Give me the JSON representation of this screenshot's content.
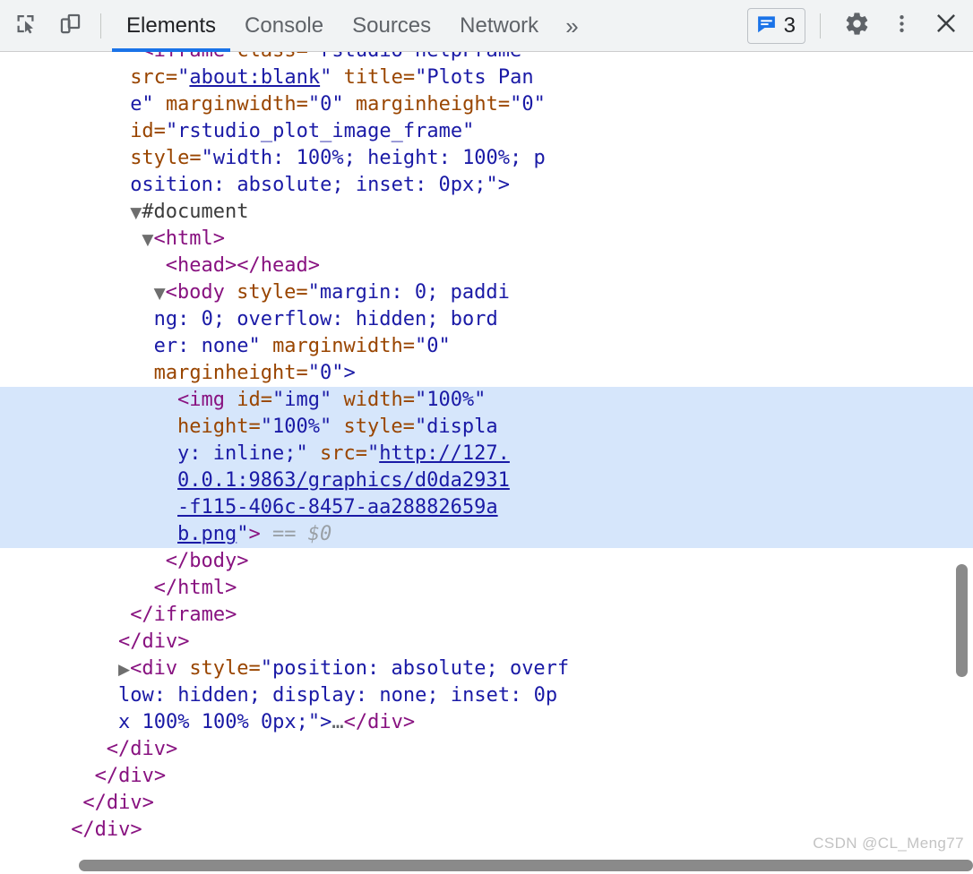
{
  "toolbar": {
    "inspect_icon": "inspect-element-icon",
    "device_icon": "device-toolbar-icon",
    "tabs": [
      {
        "label": "Elements",
        "active": true
      },
      {
        "label": "Console",
        "active": false
      },
      {
        "label": "Sources",
        "active": false
      },
      {
        "label": "Network",
        "active": false
      }
    ],
    "more_tabs_label": "»",
    "issues": {
      "icon": "issues-message-icon",
      "count": "3",
      "color": "#1a73e8"
    },
    "settings_icon": "gear-icon",
    "menu_icon": "kebab-menu-icon",
    "close_icon": "close-icon",
    "active_tab_underline_color": "#1a73e8",
    "background": "#f1f3f4"
  },
  "dom": {
    "selection_highlight_color": "#d6e6fb",
    "colors": {
      "tag": "#881280",
      "attribute": "#994500",
      "value": "#1a1aa6",
      "link": "#1a1aa6",
      "dollar_zero": "#9aa0a6"
    },
    "lines": [
      {
        "id": "l0",
        "clipped": true,
        "indent": 12,
        "parts": [
          {
            "t": "tag",
            "s": "<iframe"
          },
          {
            "t": "plain",
            "s": " "
          },
          {
            "t": "attr",
            "s": "class="
          },
          {
            "t": "val",
            "s": "\"rstudio helpFrame"
          }
        ]
      },
      {
        "id": "l1",
        "indent": 11,
        "parts": [
          {
            "t": "attr",
            "s": "src="
          },
          {
            "t": "val",
            "s": "\""
          },
          {
            "t": "link",
            "s": "about:blank"
          },
          {
            "t": "val",
            "s": "\""
          },
          {
            "t": "plain",
            "s": " "
          },
          {
            "t": "attr",
            "s": "title="
          },
          {
            "t": "val",
            "s": "\"Plots Pan"
          }
        ]
      },
      {
        "id": "l2",
        "indent": 11,
        "parts": [
          {
            "t": "val",
            "s": "e\""
          },
          {
            "t": "plain",
            "s": " "
          },
          {
            "t": "attr",
            "s": "marginwidth="
          },
          {
            "t": "val",
            "s": "\"0\""
          },
          {
            "t": "plain",
            "s": " "
          },
          {
            "t": "attr",
            "s": "marginheight="
          },
          {
            "t": "val",
            "s": "\"0\""
          }
        ]
      },
      {
        "id": "l3",
        "indent": 11,
        "parts": [
          {
            "t": "attr",
            "s": "id="
          },
          {
            "t": "val",
            "s": "\"rstudio_plot_image_frame\""
          }
        ]
      },
      {
        "id": "l4",
        "indent": 11,
        "parts": [
          {
            "t": "attr",
            "s": "style="
          },
          {
            "t": "val",
            "s": "\"width: 100%; height: 100%; p"
          }
        ]
      },
      {
        "id": "l5",
        "indent": 11,
        "parts": [
          {
            "t": "val",
            "s": "osition: absolute; inset: 0px;\">"
          }
        ]
      },
      {
        "id": "l6",
        "indent": 11,
        "twisty": "down",
        "parts": [
          {
            "t": "doc",
            "s": "#document"
          }
        ]
      },
      {
        "id": "l7",
        "indent": 12,
        "twisty": "down",
        "parts": [
          {
            "t": "tag",
            "s": "<html>"
          }
        ]
      },
      {
        "id": "l8",
        "indent": 14,
        "parts": [
          {
            "t": "tag",
            "s": "<head></head>"
          }
        ]
      },
      {
        "id": "l9",
        "indent": 13,
        "twisty": "down",
        "parts": [
          {
            "t": "tag",
            "s": "<body"
          },
          {
            "t": "plain",
            "s": " "
          },
          {
            "t": "attr",
            "s": "style="
          },
          {
            "t": "val",
            "s": "\"margin: 0; paddi"
          }
        ]
      },
      {
        "id": "l10",
        "indent": 13,
        "parts": [
          {
            "t": "val",
            "s": "ng: 0; overflow: hidden; bord"
          }
        ]
      },
      {
        "id": "l11",
        "indent": 13,
        "parts": [
          {
            "t": "val",
            "s": "er: none\""
          },
          {
            "t": "plain",
            "s": " "
          },
          {
            "t": "attr",
            "s": "marginwidth="
          },
          {
            "t": "val",
            "s": "\"0\""
          }
        ]
      },
      {
        "id": "l12",
        "indent": 13,
        "parts": [
          {
            "t": "attr",
            "s": "marginheight="
          },
          {
            "t": "val",
            "s": "\"0\">"
          }
        ]
      },
      {
        "id": "l13",
        "indent": 15,
        "selected": true,
        "parts": [
          {
            "t": "tag",
            "s": "<img"
          },
          {
            "t": "plain",
            "s": " "
          },
          {
            "t": "attr",
            "s": "id="
          },
          {
            "t": "val",
            "s": "\"img\""
          },
          {
            "t": "plain",
            "s": " "
          },
          {
            "t": "attr",
            "s": "width="
          },
          {
            "t": "val",
            "s": "\"100%\""
          }
        ]
      },
      {
        "id": "l14",
        "indent": 15,
        "selected": true,
        "parts": [
          {
            "t": "attr",
            "s": "height="
          },
          {
            "t": "val",
            "s": "\"100%\""
          },
          {
            "t": "plain",
            "s": " "
          },
          {
            "t": "attr",
            "s": "style="
          },
          {
            "t": "val",
            "s": "\"displa"
          }
        ]
      },
      {
        "id": "l15",
        "indent": 15,
        "selected": true,
        "parts": [
          {
            "t": "val",
            "s": "y: inline;\""
          },
          {
            "t": "plain",
            "s": " "
          },
          {
            "t": "attr",
            "s": "src="
          },
          {
            "t": "val",
            "s": "\""
          },
          {
            "t": "link",
            "s": "http://127."
          }
        ]
      },
      {
        "id": "l16",
        "indent": 15,
        "selected": true,
        "parts": [
          {
            "t": "link",
            "s": "0.0.1:9863/graphics/d0da2931"
          }
        ]
      },
      {
        "id": "l17",
        "indent": 15,
        "selected": true,
        "parts": [
          {
            "t": "link",
            "s": "-f115-406c-8457-aa28882659a"
          }
        ]
      },
      {
        "id": "l18",
        "indent": 15,
        "selected": true,
        "parts": [
          {
            "t": "link",
            "s": "b.png"
          },
          {
            "t": "val",
            "s": "\""
          },
          {
            "t": "tag",
            "s": ">"
          },
          {
            "t": "plain",
            "s": " "
          },
          {
            "t": "dollar",
            "s": "== $0"
          }
        ]
      },
      {
        "id": "l19",
        "indent": 14,
        "parts": [
          {
            "t": "tag",
            "s": "</body>"
          }
        ]
      },
      {
        "id": "l20",
        "indent": 13,
        "parts": [
          {
            "t": "tag",
            "s": "</html>"
          }
        ]
      },
      {
        "id": "l21",
        "indent": 11,
        "parts": [
          {
            "t": "tag",
            "s": "</iframe>"
          }
        ]
      },
      {
        "id": "l22",
        "indent": 10,
        "parts": [
          {
            "t": "tag",
            "s": "</div>"
          }
        ]
      },
      {
        "id": "l23",
        "indent": 10,
        "twisty": "right",
        "parts": [
          {
            "t": "tag",
            "s": "<div"
          },
          {
            "t": "plain",
            "s": " "
          },
          {
            "t": "attr",
            "s": "style="
          },
          {
            "t": "val",
            "s": "\"position: absolute; overf"
          }
        ]
      },
      {
        "id": "l24",
        "indent": 10,
        "parts": [
          {
            "t": "val",
            "s": "low: hidden; display: none; inset: 0p"
          }
        ]
      },
      {
        "id": "l25",
        "indent": 10,
        "parts": [
          {
            "t": "val",
            "s": "x 100% 100% 0px;\">"
          },
          {
            "t": "ellip",
            "s": "…"
          },
          {
            "t": "tag",
            "s": "</div>"
          }
        ]
      },
      {
        "id": "l26",
        "indent": 9,
        "parts": [
          {
            "t": "tag",
            "s": "</div>"
          }
        ]
      },
      {
        "id": "l27",
        "indent": 8,
        "parts": [
          {
            "t": "tag",
            "s": "</div>"
          }
        ]
      },
      {
        "id": "l28",
        "indent": 7,
        "parts": [
          {
            "t": "tag",
            "s": "</div>"
          }
        ]
      },
      {
        "id": "l29",
        "indent": 6,
        "parts": [
          {
            "t": "tag",
            "s": "</div>"
          }
        ]
      }
    ]
  },
  "scrollbars": {
    "vertical": {
      "name": "vertical-scrollbar"
    },
    "horizontal": {
      "name": "horizontal-scrollbar"
    }
  },
  "watermark": {
    "text": "CSDN @CL_Meng77"
  }
}
